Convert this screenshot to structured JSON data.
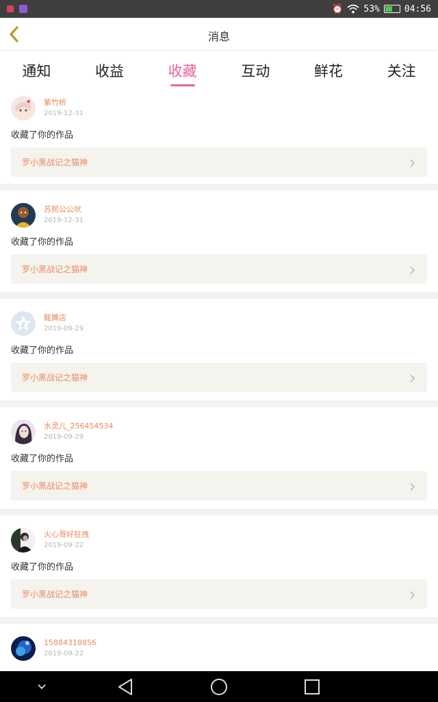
{
  "status_bar": {
    "battery_percent": "53%",
    "time": "04:56",
    "battery_level": 0.53,
    "colors": {
      "battery": "#52c450",
      "app1": "#d9415c",
      "app2": "#8e5bd6"
    }
  },
  "header": {
    "title": "消息",
    "back_icon": "chevron-left-icon"
  },
  "tabs": [
    {
      "label": "通知",
      "active": false
    },
    {
      "label": "收益",
      "active": false
    },
    {
      "label": "收藏",
      "active": true
    },
    {
      "label": "互动",
      "active": false
    },
    {
      "label": "鲜花",
      "active": false
    },
    {
      "label": "关注",
      "active": false
    }
  ],
  "accent_color": "#e6669a",
  "username_color": "#ec8a5c",
  "messages": [
    {
      "username": "紫竹桥",
      "date": "2019-12-31",
      "action": "收藏了你的作品",
      "work": "罗小黑战记之猫神",
      "avatar": "anime-girl-avatar"
    },
    {
      "username": "苏熙公公吠",
      "date": "2019-12-31",
      "action": "收藏了你的作品",
      "work": "罗小黑战记之猫神",
      "avatar": "cartoon-avatar"
    },
    {
      "username": "龍舞店",
      "date": "2019-09-29",
      "action": "收藏了你的作品",
      "work": "罗小黑战记之猫神",
      "avatar": "default-star-avatar"
    },
    {
      "username": "水灵儿_256454534",
      "date": "2019-09-29",
      "action": "收藏了你的作品",
      "work": "罗小黑战记之猫神",
      "avatar": "girl-photo-avatar"
    },
    {
      "username": "火心哥好狂拽",
      "date": "2019-09-22",
      "action": "收藏了你的作品",
      "work": "罗小黑战记之猫神",
      "avatar": "photo-avatar"
    },
    {
      "username": "15884318856",
      "date": "2019-09-22",
      "action": "",
      "work": "",
      "avatar": "blue-galaxy-avatar"
    }
  ],
  "nav_bar": {
    "icons": [
      "collapse-down-icon",
      "back-triangle-icon",
      "home-circle-icon",
      "recents-square-icon"
    ]
  }
}
